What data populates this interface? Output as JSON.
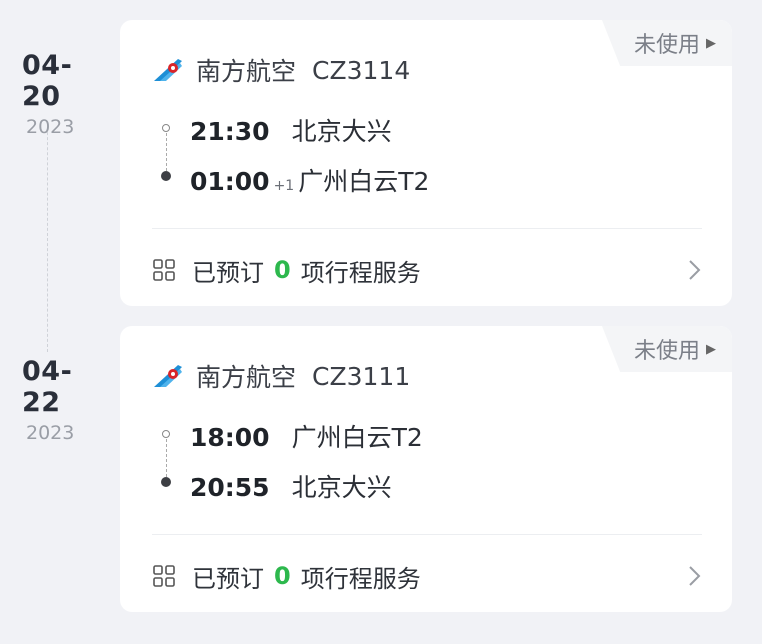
{
  "trips": [
    {
      "date_md": "04-20",
      "year": "2023",
      "status": "未使用",
      "airline": "南方航空",
      "flight_no": "CZ3114",
      "dep_time": "21:30",
      "dep_airport": "北京大兴",
      "arr_time": "01:00",
      "arr_day_offset": "+1",
      "arr_airport": "广州白云T2",
      "service_prefix": "已预订",
      "service_count": "0",
      "service_suffix": "项行程服务"
    },
    {
      "date_md": "04-22",
      "year": "2023",
      "status": "未使用",
      "airline": "南方航空",
      "flight_no": "CZ3111",
      "dep_time": "18:00",
      "dep_airport": "广州白云T2",
      "arr_time": "20:55",
      "arr_day_offset": "",
      "arr_airport": "北京大兴",
      "service_prefix": "已预订",
      "service_count": "0",
      "service_suffix": "项行程服务"
    }
  ],
  "colors": {
    "background": "#f1f2f6",
    "card": "#ffffff",
    "accent_green": "#2db84d",
    "airline_blue": "#1e8fd6",
    "airline_red": "#d9252a"
  },
  "icons": [
    "china-southern-logo-icon",
    "play-triangle-icon",
    "grid-icon",
    "chevron-right-icon"
  ]
}
